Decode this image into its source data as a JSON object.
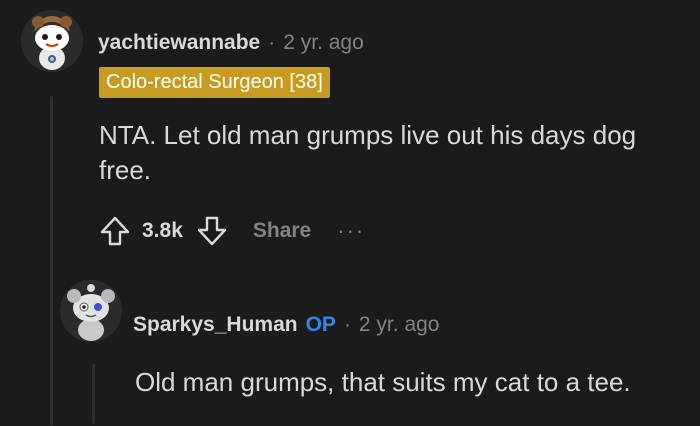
{
  "comment": {
    "username": "yachtiewannabe",
    "separator": "·",
    "time": "2 yr. ago",
    "flair": "Colo-rectal Surgeon [38]",
    "body": "NTA. Let old man grumps live out his days dog free.",
    "vote_count": "3.8k",
    "share_label": "Share",
    "more_label": "···"
  },
  "reply": {
    "username": "Sparkys_Human",
    "op_badge": "OP",
    "separator": "·",
    "time": "2 yr. ago",
    "body": "Old man grumps, that suits my cat to a tee."
  },
  "colors": {
    "background": "#1b1b1c",
    "flair_bg": "#c79b1f",
    "op_blue": "#2f87e8",
    "muted": "#818384",
    "text": "#d7dadc"
  }
}
